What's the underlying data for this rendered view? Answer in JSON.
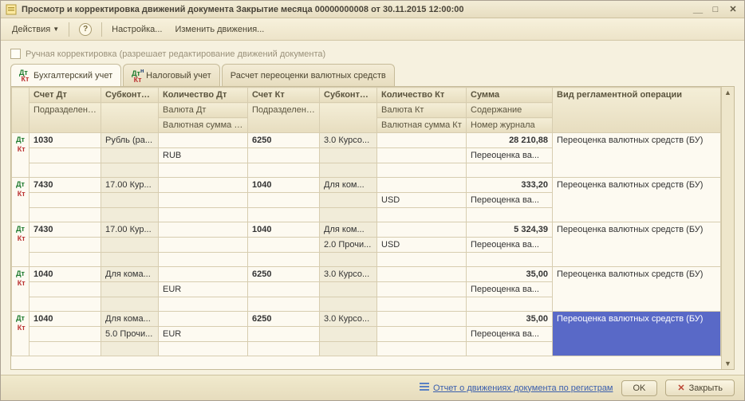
{
  "window": {
    "title": "Просмотр и корректировка движений документа Закрытие месяца 00000000008 от 30.11.2015 12:00:00"
  },
  "toolbar": {
    "actions": "Действия",
    "settings": "Настройка...",
    "change": "Изменить движения..."
  },
  "checkbox_label": "Ручная корректировка (разрешает редактирование движений документа)",
  "tabs": {
    "bu": "Бухгалтерский учет",
    "nu": "Налоговый учет",
    "fx": "Расчет переоценки валютных средств"
  },
  "headers": {
    "acct_dt": "Счет Дт",
    "subk_dt": "СубконтоДт",
    "qty_dt": "Количество Дт",
    "acct_kt": "Счет Кт",
    "subk_kt": "СубконтоКт",
    "qty_kt": "Количество Кт",
    "sum": "Сумма",
    "op": "Вид регламентной операции",
    "dept_dt": "Подразделение Дт",
    "cur_dt": "Валюта Дт",
    "dept_kt": "Подразделение Кт",
    "cur_kt": "Валюта Кт",
    "content": "Содержание",
    "fxsum_dt": "Валютная сумма Дт",
    "fxsum_kt": "Валютная сумма Кт",
    "journal": "Номер журнала"
  },
  "rows": [
    {
      "acct_dt": "1030",
      "subk_dt": "Рубль (ра...",
      "cur_dt": "RUB",
      "acct_kt": "6250",
      "subk_kt": "3.0 Курсо...",
      "sum": "28 210,88",
      "content": "Переоценка ва...",
      "op": "Переоценка валютных средств (БУ)"
    },
    {
      "acct_dt": "7430",
      "subk_dt": "17.00 Кур...",
      "acct_kt": "1040",
      "subk_kt": "Для ком...",
      "cur_kt": "USD",
      "sum": "333,20",
      "content": "Переоценка ва...",
      "op": "Переоценка валютных средств (БУ)"
    },
    {
      "acct_dt": "7430",
      "subk_dt": "17.00 Кур...",
      "acct_kt": "1040",
      "subk_kt": "Для ком...",
      "subk_kt2": "2.0 Прочи...",
      "cur_kt": "USD",
      "sum": "5 324,39",
      "content": "Переоценка ва...",
      "op": "Переоценка валютных средств (БУ)"
    },
    {
      "acct_dt": "1040",
      "subk_dt": "Для кома...",
      "cur_dt": "EUR",
      "acct_kt": "6250",
      "subk_kt": "3.0 Курсо...",
      "sum": "35,00",
      "content": "Переоценка ва...",
      "op": "Переоценка валютных средств (БУ)"
    },
    {
      "acct_dt": "1040",
      "subk_dt": "Для кома...",
      "subk_dt2": "5.0 Прочи...",
      "cur_dt": "EUR",
      "acct_kt": "6250",
      "subk_kt": "3.0 Курсо...",
      "sum": "35,00",
      "content": "Переоценка ва...",
      "op": "Переоценка валютных средств (БУ)",
      "selected": true
    }
  ],
  "footer": {
    "report_link": "Отчет о движениях документа по регистрам",
    "ok": "OK",
    "close": "Закрыть"
  }
}
